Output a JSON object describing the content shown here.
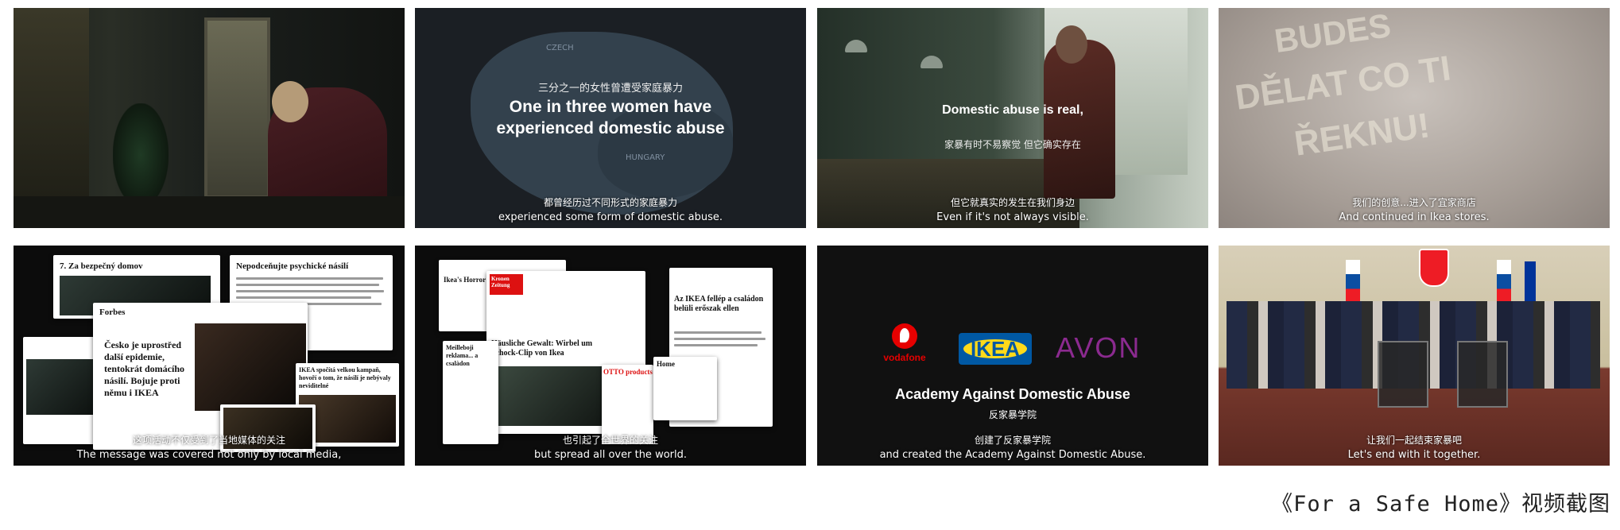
{
  "frames": [
    {
      "id": 1,
      "scene": "dark-hallway",
      "subtitle_zh": "",
      "subtitle_en": ""
    },
    {
      "id": 2,
      "scene": "map",
      "map_labels": [
        "CZECH",
        "HUNGARY"
      ],
      "headline_zh": "三分之一的女性曾遭受家庭暴力",
      "headline_en_line1": "One in three women have",
      "headline_en_line2": "experienced domestic abuse",
      "subtitle_zh": "都曾经历过不同形式的家庭暴力",
      "subtitle_en": "experienced some form of domestic abuse."
    },
    {
      "id": 3,
      "scene": "kitchen",
      "headline_en": "Domestic abuse is real,",
      "headline_zh": "家暴有时不易察觉 但它确实存在",
      "subtitle_zh": "但它就真实的发生在我们身边",
      "subtitle_en": "Even if it's not always visible."
    },
    {
      "id": 4,
      "scene": "fogged-glass",
      "glass_text": [
        "BUDES",
        "DĚLAT CO TI",
        "ŘEKNU!"
      ],
      "subtitle_zh": "我们的创意...进入了宜家商店",
      "subtitle_en": "And continued in Ikea stores."
    },
    {
      "id": 5,
      "scene": "press-collage",
      "articles": [
        "7. Za bezpečný domov",
        "Nepodceňujte psychické násilí",
        "Forbes",
        "Česko je uprostřed další epidemie, tentokrát domácího násilí. Bojuje proti němu i IKEA",
        "IKEA spočítá velkou kampaň, hovoří o tom, že násilí je nebývaly neviditelné",
        "IKEA spočítá velkou kampaň, hovoří o tom, že násilí je nebývaly neviditelné"
      ],
      "subtitle_zh": "这项活动不仅受到了当地媒体的关注",
      "subtitle_en": "The message was covered not only by local media,"
    },
    {
      "id": 6,
      "scene": "press-collage-international",
      "articles": [
        "Ikea's Horror Ad... for Many, Home...",
        "Kronen Zeitung",
        "Häusliche Gewalt: Wirbel um Schock-Clip von Ikea",
        "Az IKEA fellép a családon belüli erőszak ellen",
        "Meilleboji reklama... a csalàdon",
        "OTTO products",
        "Home"
      ],
      "subtitle_zh": "也引起了全世界的关注",
      "subtitle_en": "but spread all over the world."
    },
    {
      "id": 7,
      "scene": "logos",
      "logos": {
        "vodafone": "vodafone",
        "ikea": "IKEA",
        "avon": "AVON"
      },
      "title_en": "Academy Against Domestic Abuse",
      "title_zh": "反家暴学院",
      "subtitle_zh": "创建了反家暴学院",
      "subtitle_en": "and created the Academy Against Domestic Abuse."
    },
    {
      "id": 8,
      "scene": "press-conference",
      "subtitle_zh": "让我们一起结束家暴吧",
      "subtitle_en": "Let's end with it together."
    }
  ],
  "caption": "《For a Safe Home》视频截图",
  "colors": {
    "ikea_blue": "#0058a3",
    "ikea_yellow": "#ffda1a",
    "vodafone_red": "#e60000",
    "avon_purple": "#8b2a8f",
    "frame_dark": "#111111"
  }
}
